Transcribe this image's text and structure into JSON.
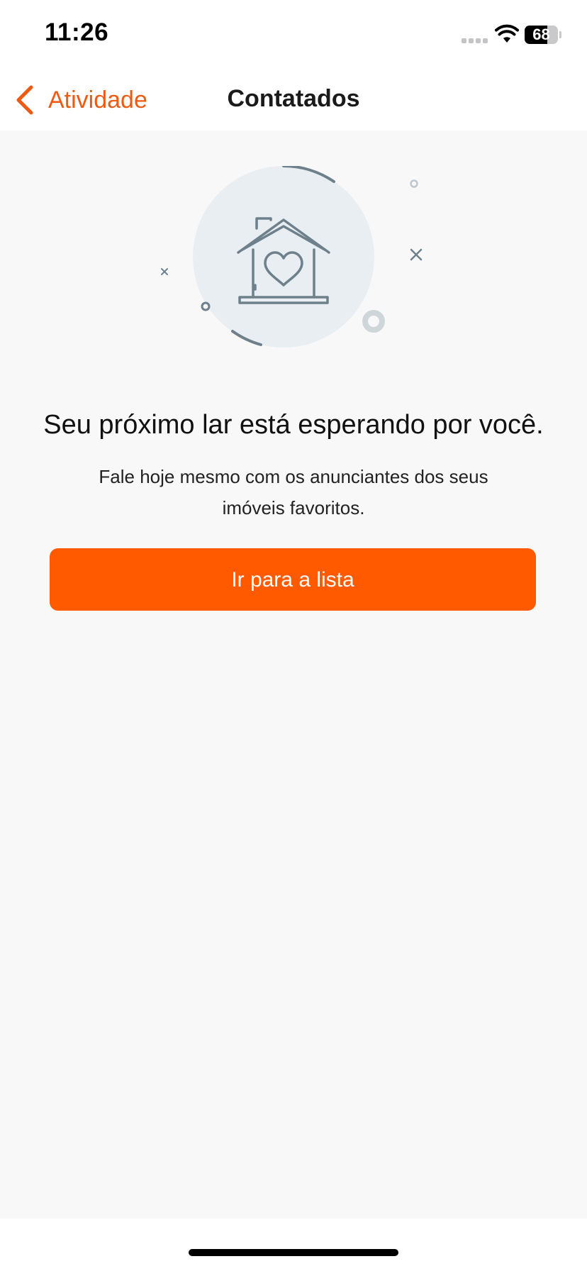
{
  "status_bar": {
    "time": "11:26",
    "battery_level": "68",
    "battery_fraction": 0.68,
    "icons": [
      "cellular-signal-icon",
      "wifi-icon",
      "battery-icon"
    ]
  },
  "nav": {
    "back_label": "Atividade",
    "back_icon": "chevron-left-icon",
    "title": "Contatados"
  },
  "empty_state": {
    "illustration_icon": "house-heart-icon",
    "headline": "Seu próximo lar está esperando por você.",
    "description": "Fale hoje mesmo com os anunciantes dos seus imóveis favoritos.",
    "button_label": "Ir para a lista"
  },
  "colors": {
    "accent": "#ff5a00",
    "nav_accent": "#ef5a12",
    "background": "#f8f8f8",
    "illustration_circle": "#e8eef1",
    "illustration_stroke": "#6e808b"
  }
}
